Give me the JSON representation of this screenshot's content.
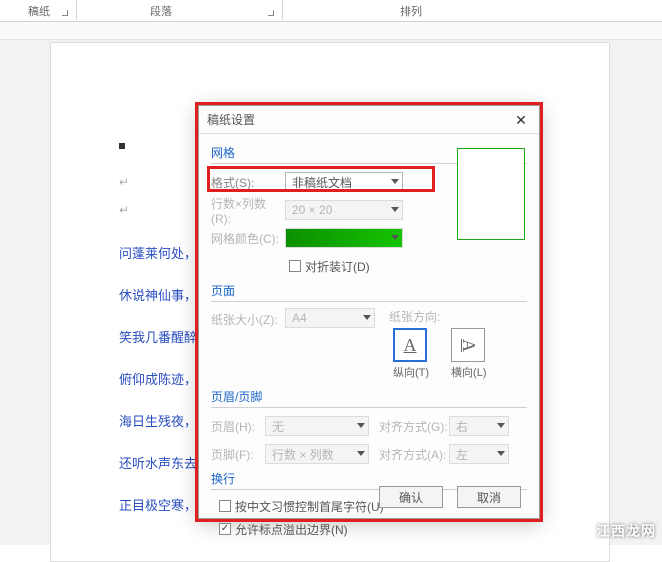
{
  "ribbon": {
    "group1": "稿纸",
    "group2": "段落",
    "group3": "排列"
  },
  "doc_lines": [
    "问蓬莱何处，",
    "休说神仙事，",
    "笑我几番醒醉",
    "俯仰成陈迹，",
    "海日生残夜，",
    "还听水声东去",
    "正目极空寒，萧萧汉柏愁茂陵。"
  ],
  "dialog": {
    "title": "稿纸设置",
    "sections": {
      "grid": "网格",
      "page": "页面",
      "headerfooter": "页眉/页脚",
      "newline": "换行"
    },
    "format_label": "格式(S):",
    "format_value": "非稿纸文档",
    "rowscols_label": "行数×列数(R):",
    "rowscols_value": "20 × 20",
    "gridcolor_label": "网格颜色(C):",
    "booklet_label": "对折装订(D)",
    "papersize_label": "纸张大小(Z):",
    "papersize_value": "A4",
    "orient_label": "纸张方向:",
    "orient_portrait": "纵向(T)",
    "orient_landscape": "横向(L)",
    "header_label": "页眉(H):",
    "header_value": "无",
    "header_align_label": "对齐方式(G):",
    "header_align_value": "右",
    "footer_label": "页脚(F):",
    "footer_value": "行数 × 列数",
    "footer_align_label": "对齐方式(A):",
    "footer_align_value": "左",
    "cjk_label": "按中文习惯控制首尾字符(U)",
    "punct_label": "允许标点溢出边界(N)",
    "ok": "确认",
    "cancel": "取消"
  },
  "watermark": "江西龙网"
}
